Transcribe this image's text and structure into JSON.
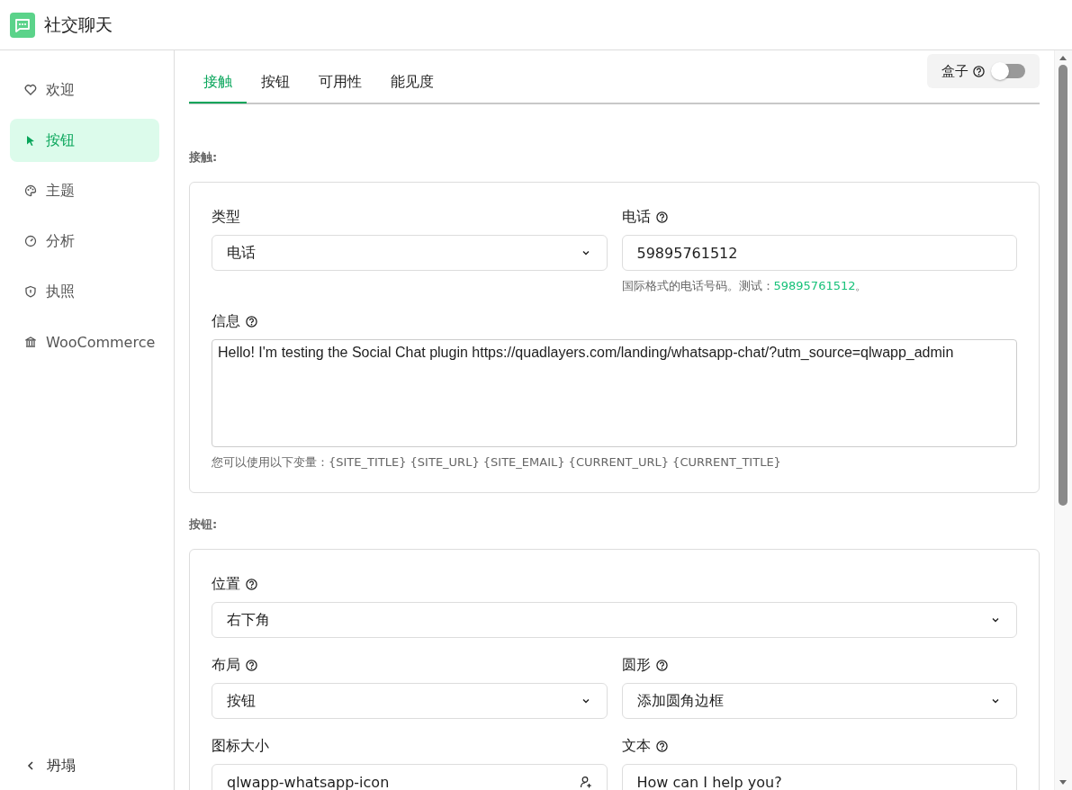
{
  "app": {
    "title": "社交聊天"
  },
  "sidebar": {
    "items": [
      {
        "label": "欢迎",
        "selected": false
      },
      {
        "label": "按钮",
        "selected": true
      },
      {
        "label": "主题",
        "selected": false
      },
      {
        "label": "分析",
        "selected": false
      },
      {
        "label": "执照",
        "selected": false
      },
      {
        "label": "WooCommerce",
        "selected": false
      }
    ],
    "collapse": {
      "label": "坍塌"
    }
  },
  "tabs": [
    {
      "label": "接触",
      "selected": true
    },
    {
      "label": "按钮",
      "selected": false
    },
    {
      "label": "可用性",
      "selected": false
    },
    {
      "label": "能见度",
      "selected": false
    }
  ],
  "box_toggle": {
    "label": "盒子",
    "on": false
  },
  "sections": [
    {
      "title": "接触:",
      "rows": [
        {
          "fields": [
            {
              "label": "类型",
              "help": false,
              "kind": "select",
              "value": "电话"
            },
            {
              "label": "电话",
              "help": true,
              "kind": "input",
              "value": "59895761512",
              "hint": [
                {
                  "text": "国际格式的电话号码。测试：",
                  "highlight": false
                },
                {
                  "text": "59895761512",
                  "highlight": true
                },
                {
                  "text": "。",
                  "highlight": false
                }
              ]
            }
          ]
        },
        {
          "fields": [
            {
              "label": "信息",
              "help": true,
              "kind": "textarea",
              "value": "Hello! I'm testing the Social Chat plugin https://quadlayers.com/landing/whatsapp-chat/?utm_source=qlwapp_admin",
              "hint": [
                {
                  "text": "您可以使用以下变量：{SITE_TITLE} {SITE_URL} {SITE_EMAIL} {CURRENT_URL} {CURRENT_TITLE}",
                  "highlight": false
                }
              ]
            }
          ]
        }
      ]
    },
    {
      "title": "按钮:",
      "rows": [
        {
          "fields": [
            {
              "label": "位置",
              "help": true,
              "kind": "select",
              "value": "右下角"
            }
          ]
        },
        {
          "fields": [
            {
              "label": "布局",
              "help": true,
              "kind": "select",
              "value": "按钮"
            },
            {
              "label": "圆形",
              "help": true,
              "kind": "select",
              "value": "添加圆角边框"
            }
          ]
        },
        {
          "fields": [
            {
              "label": "图标大小",
              "help": false,
              "kind": "icon-input",
              "value": "qlwapp-whatsapp-icon"
            },
            {
              "label": "文本",
              "help": true,
              "kind": "input",
              "value": "How can I help you?"
            }
          ]
        }
      ]
    }
  ]
}
